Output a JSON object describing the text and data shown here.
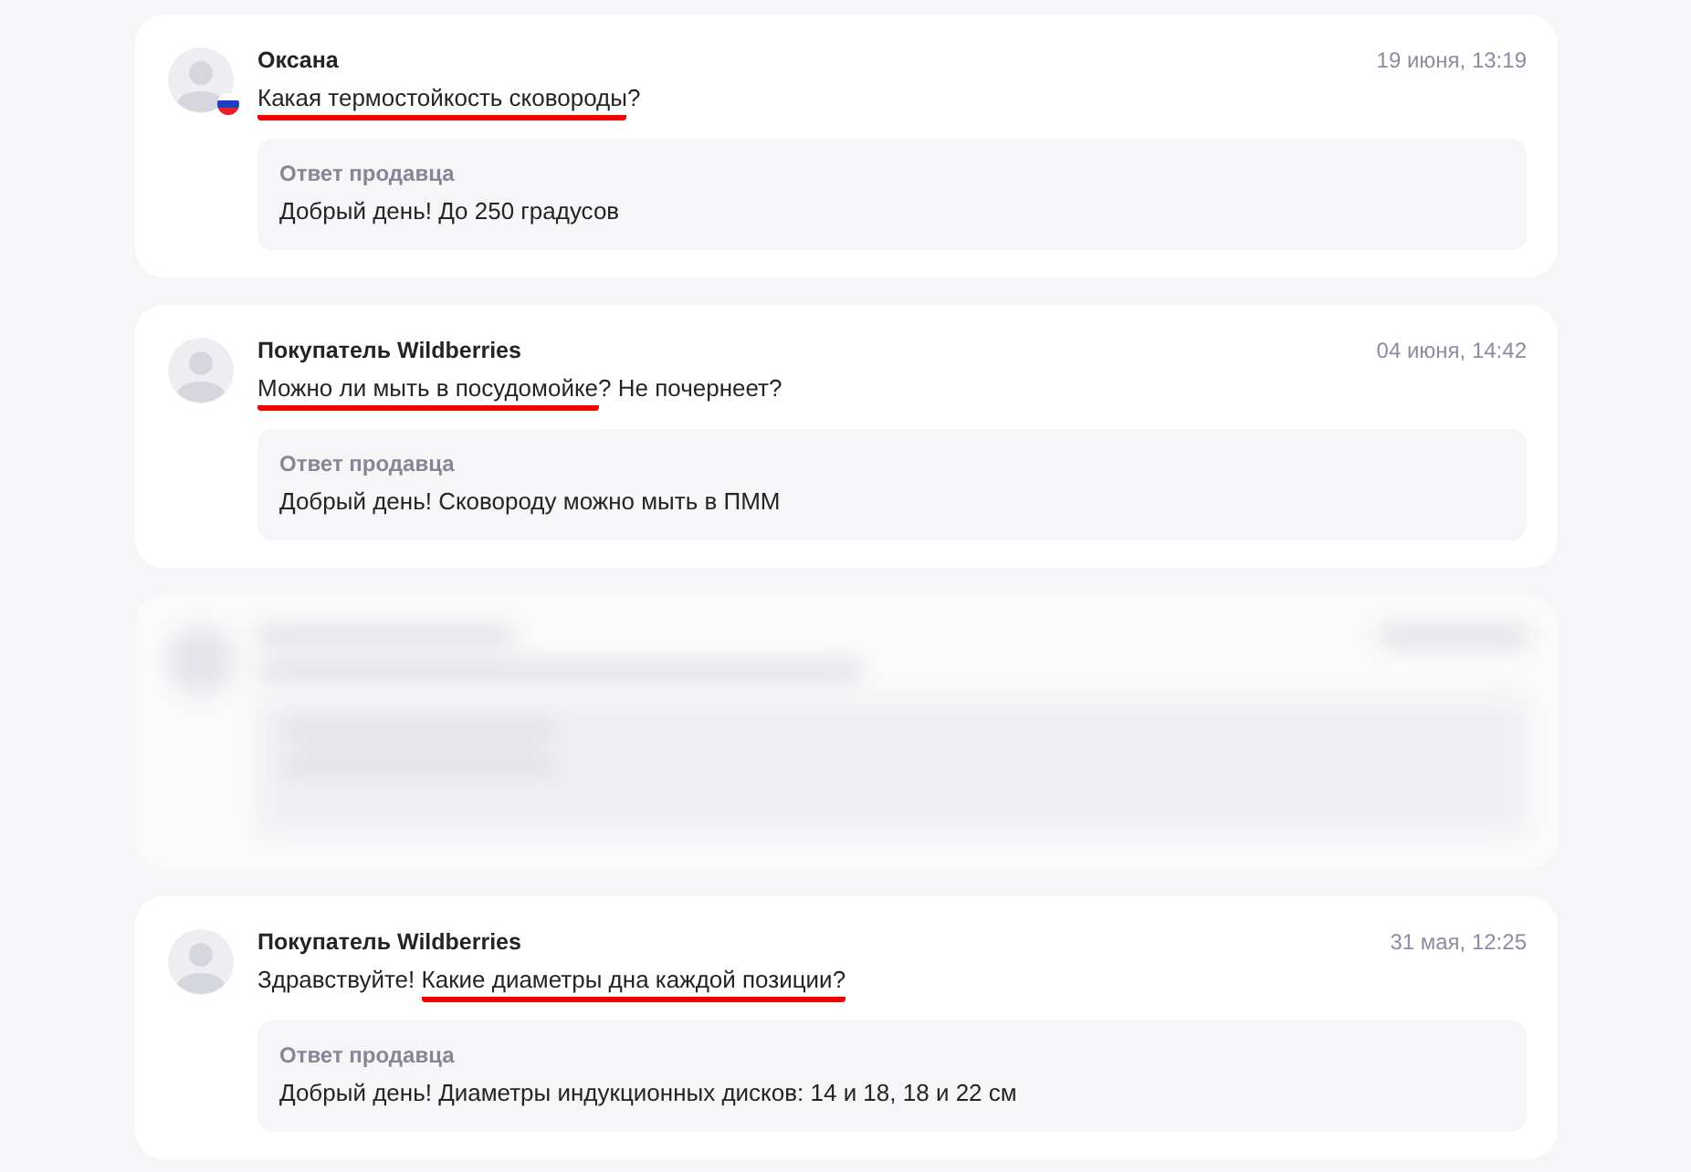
{
  "questions": [
    {
      "kind": "question",
      "author": "Оксана",
      "flag": true,
      "date": "19 июня, 13:19",
      "question": [
        {
          "text": "Какая термостойкость сковороды",
          "underlined": true
        },
        {
          "text": "?",
          "underlined": false
        }
      ],
      "answer": {
        "label": "Ответ продавца",
        "text": "Добрый день! До 250 градусов"
      }
    },
    {
      "kind": "question",
      "author": "Покупатель Wildberries",
      "flag": false,
      "date": "04 июня, 14:42",
      "question": [
        {
          "text": "Можно ли мыть в посудомойке",
          "underlined": true
        },
        {
          "text": "? Не почернеет?",
          "underlined": false
        }
      ],
      "answer": {
        "label": "Ответ продавца",
        "text": "Добрый день! Сковороду можно мыть в ПММ"
      }
    },
    {
      "kind": "blurred"
    },
    {
      "kind": "question",
      "author": "Покупатель Wildberries",
      "flag": false,
      "date": "31 мая, 12:25",
      "question": [
        {
          "text": "Здравствуйте! ",
          "underlined": false
        },
        {
          "text": "Какие диаметры дна каждой позиции?",
          "underlined": true
        }
      ],
      "answer": {
        "label": "Ответ продавца",
        "text": "Добрый день! Диаметры индукционных дисков: 14 и 18, 18 и 22 см"
      }
    }
  ]
}
